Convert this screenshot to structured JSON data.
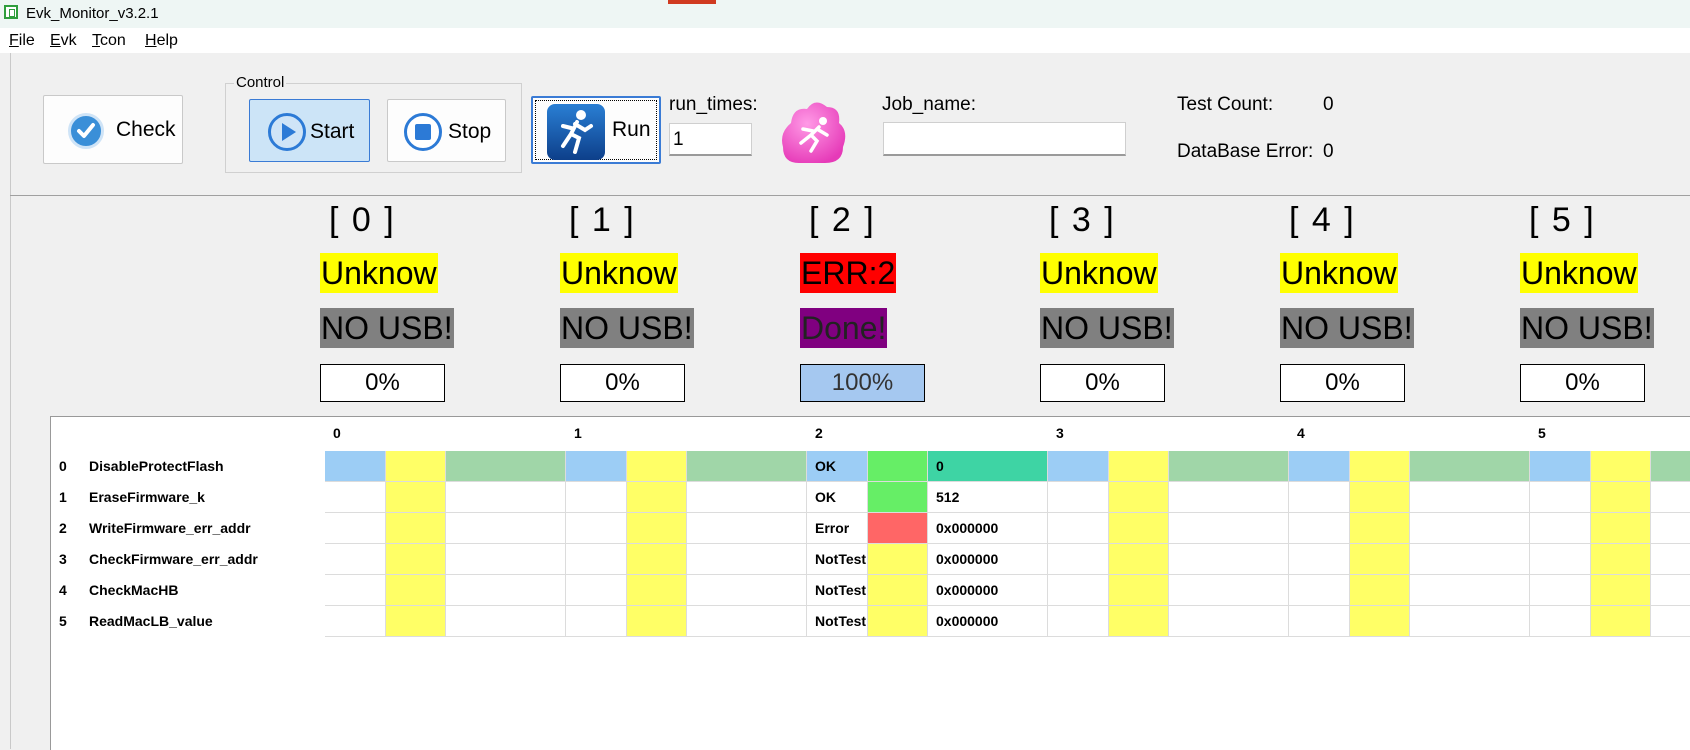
{
  "window": {
    "title": "Evk_Monitor_v3.2.1"
  },
  "menu": {
    "items": [
      {
        "letter": "F",
        "rest": "ile"
      },
      {
        "letter": "E",
        "rest": "vk"
      },
      {
        "letter": "T",
        "rest": "con"
      },
      {
        "letter": "H",
        "rest": "elp"
      }
    ]
  },
  "toolbar": {
    "check_label": "Check",
    "control_group_title": "Control",
    "start_label": "Start",
    "stop_label": "Stop",
    "run_label": "Run",
    "run_times_label": "run_times:",
    "run_times_value": "1",
    "job_name_label": "Job_name:",
    "job_name_value": "",
    "test_count_label": "Test Count:",
    "test_count_value": "0",
    "db_error_label": "DataBase Error:",
    "db_error_value": "0"
  },
  "channels": [
    {
      "title": "[ 0 ]",
      "state": "Unknow",
      "usb": "NO USB!",
      "progress": "0%",
      "progress_value": 0
    },
    {
      "title": "[ 1 ]",
      "state": "Unknow",
      "usb": "NO USB!",
      "progress": "0%",
      "progress_value": 0
    },
    {
      "title": "[ 2 ]",
      "state": "ERR:2",
      "usb": "Done!",
      "progress": "100%",
      "progress_value": 100
    },
    {
      "title": "[ 3 ]",
      "state": "Unknow",
      "usb": "NO USB!",
      "progress": "0%",
      "progress_value": 0
    },
    {
      "title": "[ 4 ]",
      "state": "Unknow",
      "usb": "NO USB!",
      "progress": "0%",
      "progress_value": 0
    },
    {
      "title": "[ 5 ]",
      "state": "Unknow",
      "usb": "NO USB!",
      "progress": "0%",
      "progress_value": 0
    }
  ],
  "colors": {
    "unknow_bg": "#ffff00",
    "err_bg": "#ff0000",
    "no_usb_bg": "#808080",
    "done_bg": "#800080",
    "progress_full_bg": "#a5c8f0",
    "row_blue": "#9ccdf5",
    "row_yellow": "#ffff66",
    "row_green": "#a0d6a8",
    "ok_green": "#66ee66",
    "error_red": "#ff6666",
    "value_teal": "#3ed4a4"
  },
  "table": {
    "column_headers": [
      "0",
      "1",
      "2",
      "3",
      "4",
      "5"
    ],
    "rows": [
      {
        "index": "0",
        "name": "DisableProtectFlash"
      },
      {
        "index": "1",
        "name": "EraseFirmware_k"
      },
      {
        "index": "2",
        "name": "WriteFirmware_err_addr"
      },
      {
        "index": "3",
        "name": "CheckFirmware_err_addr"
      },
      {
        "index": "4",
        "name": "CheckMacHB"
      },
      {
        "index": "5",
        "name": "ReadMacLB_value"
      }
    ],
    "channel2_results": [
      {
        "status": "OK",
        "color": "ok_green",
        "value": "0"
      },
      {
        "status": "OK",
        "color": "ok_green",
        "value": "512"
      },
      {
        "status": "Error",
        "color": "error_red",
        "value": "0x000000"
      },
      {
        "status": "NotTest",
        "color": "row_yellow",
        "value": "0x000000"
      },
      {
        "status": "NotTest",
        "color": "row_yellow",
        "value": "0x000000"
      },
      {
        "status": "NotTest",
        "color": "row_yellow",
        "value": "0x000000"
      }
    ]
  }
}
